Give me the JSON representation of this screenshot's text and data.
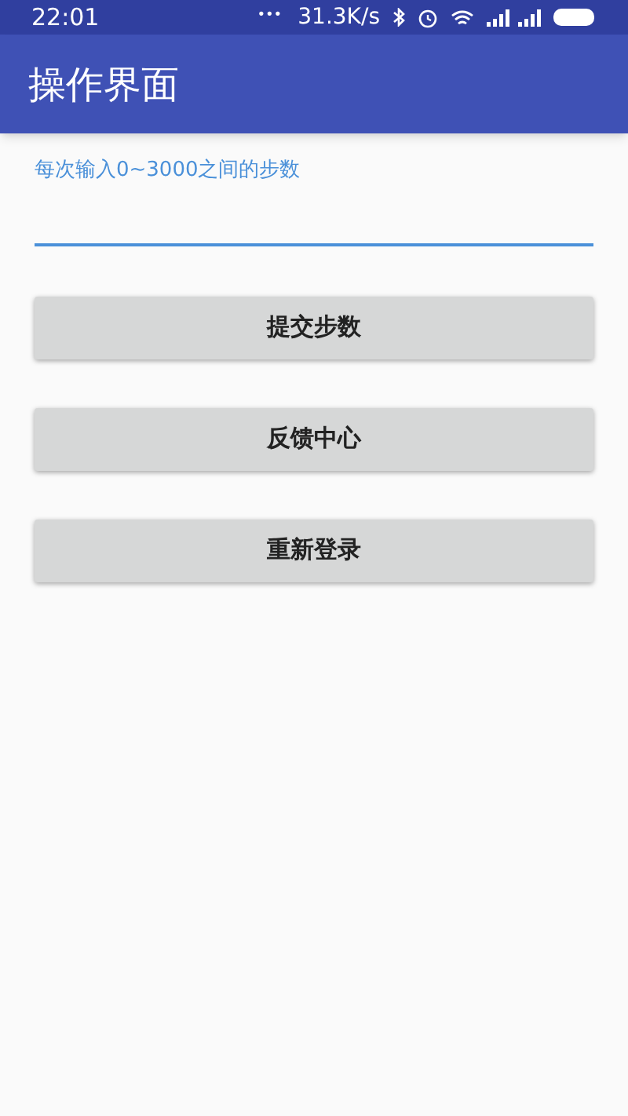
{
  "status_bar": {
    "time": "22:01",
    "dots": "•••",
    "speed": "31.3K/s"
  },
  "app_bar": {
    "title": "操作界面"
  },
  "step_field": {
    "label": "每次输入0~3000之间的步数",
    "focused": true
  },
  "buttons": [
    "提交步数",
    "反馈中心",
    "重新登录"
  ]
}
